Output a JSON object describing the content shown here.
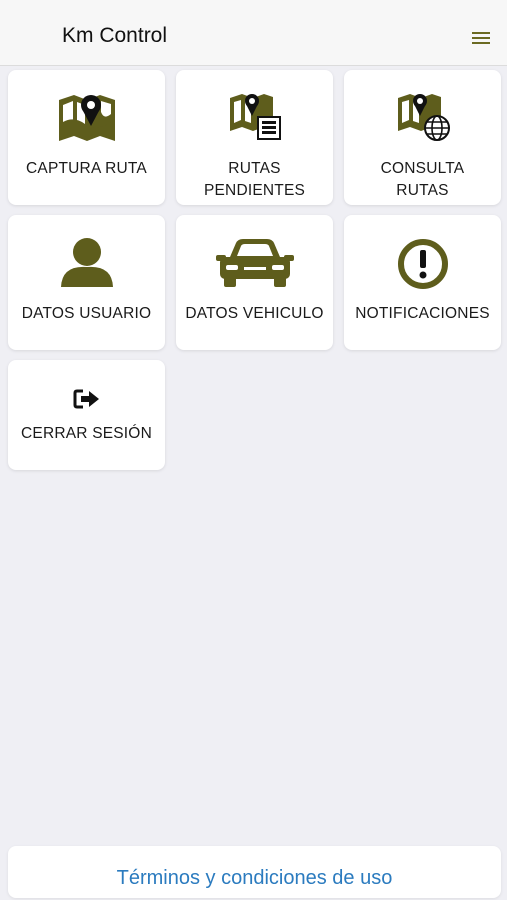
{
  "header": {
    "title": "Km Control",
    "menu_icon": "hamburger-menu-icon"
  },
  "accent_color": "#5e5d1c",
  "tiles": [
    {
      "label": "CAPTURA RUTA",
      "icon": "map-pin-icon"
    },
    {
      "label": "RUTAS\nPENDIENTES",
      "icon": "map-list-icon"
    },
    {
      "label": "CONSULTA\nRUTAS",
      "icon": "map-globe-icon"
    },
    {
      "label": "DATOS USUARIO",
      "icon": "user-icon"
    },
    {
      "label": "DATOS VEHICULO",
      "icon": "car-icon"
    },
    {
      "label": "NOTIFICACIONES",
      "icon": "exclamation-circle-icon"
    },
    {
      "label": "CERRAR SESIÓN",
      "icon": "sign-out-icon"
    }
  ],
  "footer": {
    "link_text": "Términos y condiciones de uso"
  }
}
